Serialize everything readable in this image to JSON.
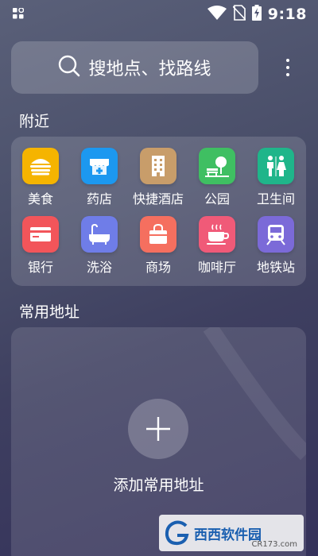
{
  "status_bar": {
    "time": "9:18"
  },
  "search": {
    "placeholder": "搜地点、找路线"
  },
  "nearby": {
    "title": "附近",
    "items": [
      {
        "label": "美食",
        "icon": "burger-icon",
        "color": "#f5b400"
      },
      {
        "label": "药店",
        "icon": "pharmacy-icon",
        "color": "#1c98f0"
      },
      {
        "label": "快捷酒店",
        "icon": "hotel-icon",
        "color": "#c89d6a"
      },
      {
        "label": "公园",
        "icon": "park-icon",
        "color": "#3fbf62"
      },
      {
        "label": "卫生间",
        "icon": "restroom-icon",
        "color": "#1fb58a"
      },
      {
        "label": "银行",
        "icon": "bank-card-icon",
        "color": "#f2555a"
      },
      {
        "label": "洗浴",
        "icon": "bathtub-icon",
        "color": "#6f7de8"
      },
      {
        "label": "商场",
        "icon": "shopping-bag-icon",
        "color": "#f56f5f"
      },
      {
        "label": "咖啡厅",
        "icon": "coffee-cup-icon",
        "color": "#f05a78"
      },
      {
        "label": "地铁站",
        "icon": "subway-icon",
        "color": "#7b6ad8"
      }
    ]
  },
  "addresses": {
    "title": "常用地址",
    "add_label": "添加常用地址"
  },
  "watermark": {
    "brand": "西西软件园",
    "domain": "CR173.com"
  }
}
